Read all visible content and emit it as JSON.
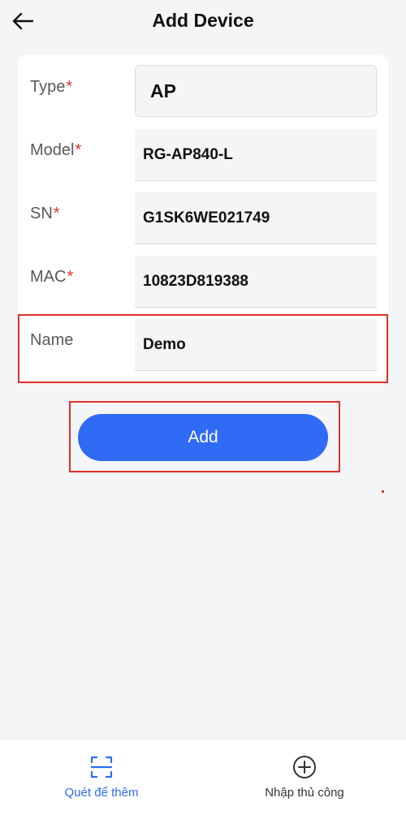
{
  "header": {
    "title": "Add Device"
  },
  "form": {
    "type": {
      "label": "Type",
      "required": "*",
      "value": "AP"
    },
    "model": {
      "label": "Model",
      "required": "*",
      "value": "RG-AP840-L"
    },
    "sn": {
      "label": "SN",
      "required": "*",
      "value": "G1SK6WE021749"
    },
    "mac": {
      "label": "MAC",
      "required": "*",
      "value": "10823D819388"
    },
    "name": {
      "label": "Name",
      "value": "Demo"
    }
  },
  "add_button": {
    "label": "Add"
  },
  "bottom_nav": {
    "scan": {
      "label": "Quét để thêm",
      "icon": "scan-icon"
    },
    "manual": {
      "label": "Nhập thủ công",
      "icon": "plus-circle-icon"
    }
  },
  "colors": {
    "accent": "#2f6bf5",
    "required": "#e0302a",
    "highlight": "#e0302a",
    "background": "#f4f5f7",
    "active_tab": "#2f6bf5",
    "inactive_tab": "#333333"
  }
}
